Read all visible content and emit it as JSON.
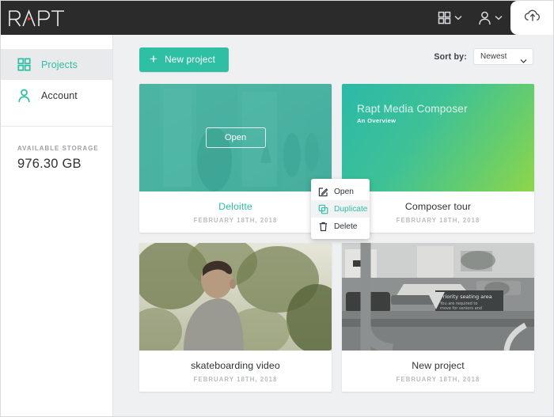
{
  "app": {
    "brand": "RAPT",
    "accent": "#2ebfa5",
    "topbar_bg": "#2b2b2b",
    "canvas_bg": "#eff0f2"
  },
  "topbar": {
    "apps_menu": {
      "icon": "grid-icon",
      "chevron": "chevron-down-icon"
    },
    "account_menu": {
      "icon": "user-icon",
      "chevron": "chevron-down-icon"
    },
    "upload": {
      "icon": "cloud-upload-icon"
    }
  },
  "sidebar": {
    "items": [
      {
        "label": "Projects",
        "icon": "grid-icon",
        "active": true
      },
      {
        "label": "Account",
        "icon": "user-icon",
        "active": false
      }
    ],
    "storage": {
      "label": "AVAILABLE STORAGE",
      "value": "976.30 GB"
    }
  },
  "toolbar": {
    "new_project_label": "New project",
    "new_project_icon": "plus-icon",
    "sort_label": "Sort by:",
    "sort_value": "Newest",
    "sort_options": [
      "Newest"
    ],
    "sort_chevron": "chevron-down-icon"
  },
  "projects": [
    {
      "title": "Deloitte",
      "date": "FEBRUARY 18TH, 2018",
      "hovered": true,
      "open_label": "Open",
      "thumb": "storefront-photo"
    },
    {
      "title": "Composer tour",
      "date": "FEBRUARY 18TH, 2018",
      "hovered": false,
      "thumb": "gradient-slide",
      "slide_title": "Rapt Media Composer",
      "slide_subtitle": "An Overview"
    },
    {
      "title": "skateboarding video",
      "date": "FEBRUARY 18TH, 2018",
      "hovered": false,
      "thumb": "person-trees-photo"
    },
    {
      "title": "New project",
      "date": "FEBRUARY 18TH, 2018",
      "hovered": false,
      "thumb": "bus-window-bw-photo"
    }
  ],
  "context_menu": {
    "items": [
      {
        "label": "Open",
        "icon": "edit-square-icon",
        "active": false
      },
      {
        "label": "Duplicate",
        "icon": "copy-icon",
        "active": true
      },
      {
        "label": "Delete",
        "icon": "trash-icon",
        "active": false
      }
    ]
  }
}
